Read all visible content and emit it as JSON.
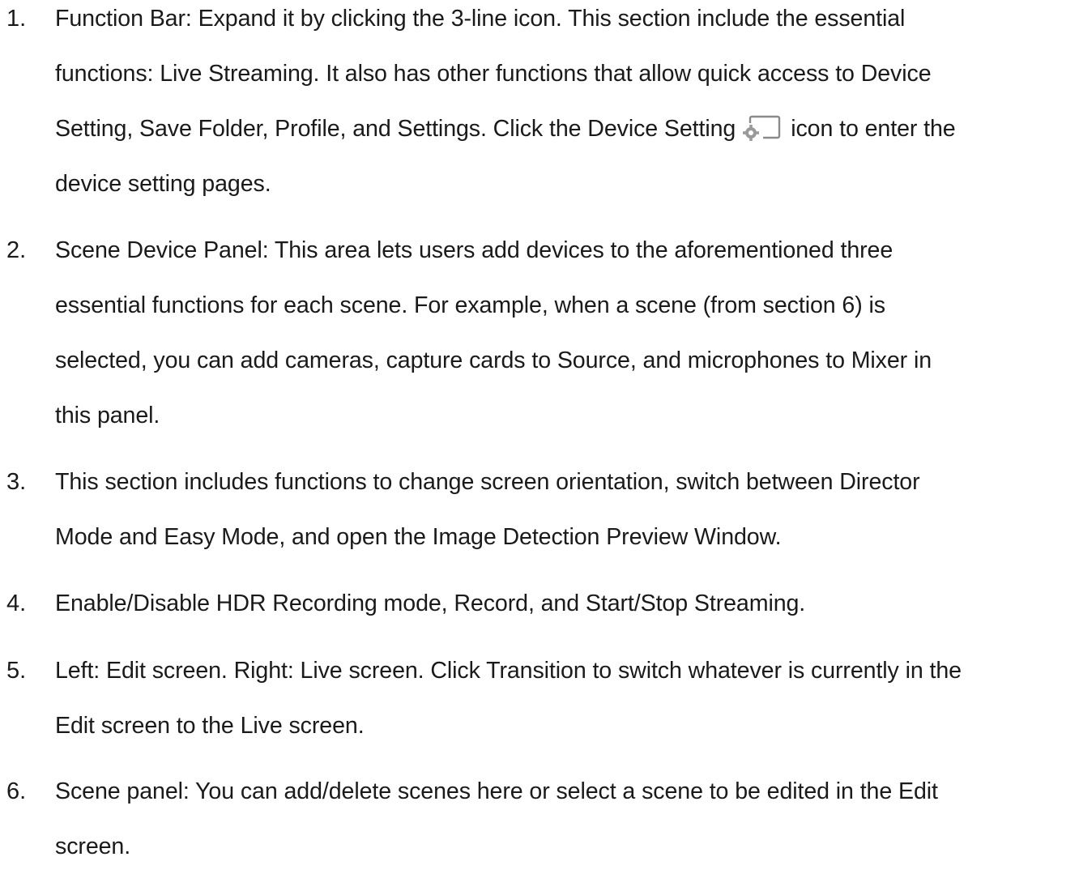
{
  "items": [
    {
      "number": "1.",
      "lines": [
        "Function Bar: Expand it by clicking the 3-line icon. This section include the essential",
        "functions: Live Streaming. It also has other functions that allow quick access to Device",
        "Setting, Save Folder, Profile, and Settings. Click the Device Setting",
        "icon to enter the",
        "device setting pages."
      ],
      "icon": "device-setting-icon"
    },
    {
      "number": "2.",
      "lines": [
        "Scene Device Panel: This area lets users add devices to the aforementioned three",
        "essential functions for each scene. For example, when a scene (from section 6) is",
        "selected, you can add cameras, capture cards to Source, and microphones to Mixer in",
        "this panel."
      ]
    },
    {
      "number": "3.",
      "lines": [
        "This section includes functions to change screen orientation, switch between Director",
        "Mode and Easy Mode, and open the Image Detection Preview Window."
      ]
    },
    {
      "number": "4.",
      "lines": [
        "Enable/Disable HDR Recording mode, Record, and Start/Stop Streaming."
      ]
    },
    {
      "number": "5.",
      "lines": [
        "Left: Edit screen. Right: Live screen. Click Transition to switch whatever is currently in the",
        "Edit screen to the Live screen."
      ]
    },
    {
      "number": "6.",
      "lines": [
        "Scene panel: You can add/delete scenes here or select a scene to be edited in the Edit",
        "screen."
      ]
    }
  ]
}
